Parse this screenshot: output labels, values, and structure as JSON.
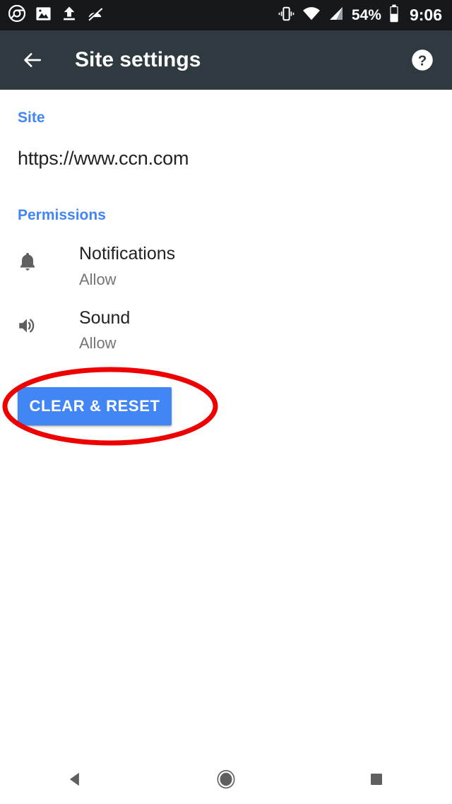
{
  "status_bar": {
    "background_color": "#15191c",
    "left_icons": [
      {
        "name": "chrome-icon",
        "label": "Chrome"
      },
      {
        "name": "image-icon",
        "label": "Screenshot saved"
      },
      {
        "name": "upload-icon",
        "label": "Uploading"
      },
      {
        "name": "data-saver-off-icon",
        "label": "Data saver off"
      }
    ],
    "right_icons": [
      {
        "name": "vibrate-icon",
        "label": "Vibrate"
      },
      {
        "name": "wifi-icon",
        "label": "Wi-Fi"
      },
      {
        "name": "cellular-signal-icon",
        "label": "Cellular signal"
      }
    ],
    "battery_percent": "54%",
    "clock": "9:06"
  },
  "app_bar": {
    "background_color": "#2e3a40",
    "title": "Site settings",
    "back_label": "Back",
    "help_label": "Help"
  },
  "content": {
    "site_section": {
      "header": "Site",
      "header_color": "#4285f4",
      "url": "https://www.ccn.com"
    },
    "permissions_section": {
      "header": "Permissions",
      "items": [
        {
          "icon": "bell-icon",
          "title": "Notifications",
          "state": "Allow"
        },
        {
          "icon": "volume-up-icon",
          "title": "Sound",
          "state": "Allow"
        }
      ]
    },
    "clear_reset_button": {
      "label": "CLEAR & RESET",
      "color": "#4285f4",
      "text_color": "#ffffff"
    },
    "annotation": {
      "shape": "ellipse",
      "color": "#ee0000",
      "target": "clear-reset-button"
    }
  },
  "nav_bar": {
    "back_label": "Back",
    "home_label": "Home",
    "recents_label": "Recent apps"
  }
}
